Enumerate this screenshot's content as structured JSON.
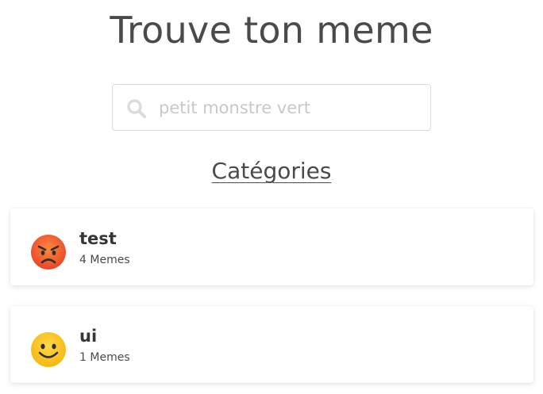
{
  "header": {
    "title": "Trouve ton meme"
  },
  "search": {
    "placeholder": "petit monstre vert",
    "value": "",
    "icon": "search-icon"
  },
  "categories": {
    "heading": "Catégories",
    "items": [
      {
        "name": "test",
        "count": "4",
        "count_label": "Memes",
        "icon": "angry-face-icon"
      },
      {
        "name": "ui",
        "count": "1",
        "count_label": "Memes",
        "icon": "slightly-smiling-face-icon"
      }
    ]
  },
  "colors": {
    "title": "#4a4a4a",
    "search_icon": "#dbdbdb",
    "placeholder": "#c8c8c8",
    "emoji_angry": "#f05a28",
    "emoji_smile": "#fcc21b"
  }
}
